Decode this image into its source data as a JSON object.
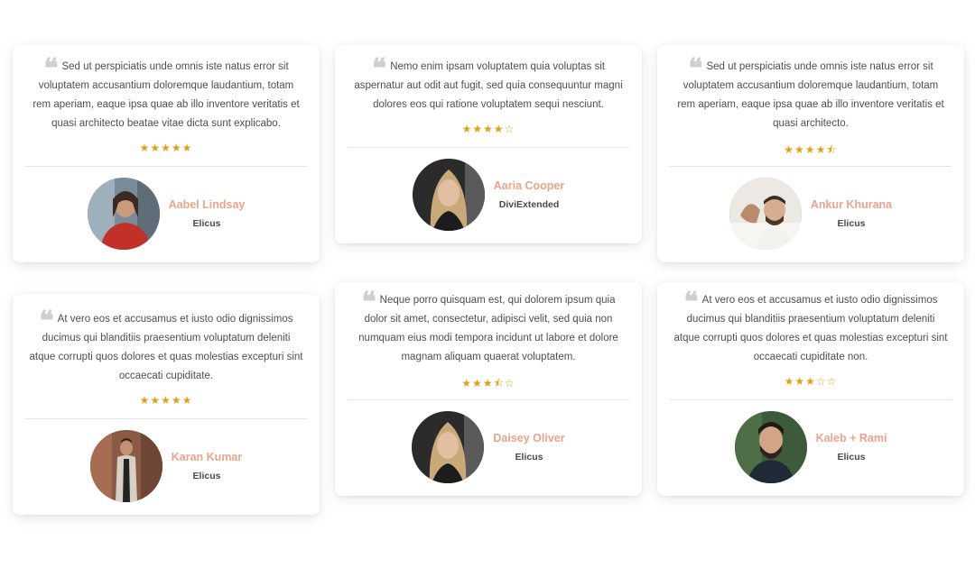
{
  "testimonials": [
    {
      "quote": "Sed ut perspiciatis unde omnis iste natus error sit voluptatem accusantium doloremque laudantium, totam rem aperiam, eaque ipsa quae ab illo inventore veritatis et quasi architecto beatae vitae dicta sunt explicabo.",
      "stars": "★★★★★",
      "rating": 5,
      "name": "Aabel Lindsay",
      "company": "Elicus"
    },
    {
      "quote": "Nemo enim ipsam voluptatem quia voluptas sit aspernatur aut odit aut fugit, sed quia consequuntur magni dolores eos qui ratione voluptatem sequi nesciunt.",
      "stars": "★★★★☆",
      "rating": 4,
      "name": "Aaria Cooper",
      "company": "DiviExtended"
    },
    {
      "quote": "Sed ut perspiciatis unde omnis iste natus error sit voluptatem accusantium doloremque laudantium, totam rem aperiam, eaque ipsa quae ab illo inventore veritatis et quasi architecto.",
      "stars": "★★★★⯪",
      "rating": 4.5,
      "name": "Ankur Khurana",
      "company": "Elicus"
    },
    {
      "quote": "At vero eos et accusamus et iusto odio dignissimos ducimus qui blanditiis praesentium voluptatum deleniti atque corrupti quos dolores et quas molestias excepturi sint occaecati cupiditate.",
      "stars": "★★★★★",
      "rating": 5,
      "name": "Karan Kumar",
      "company": "Elicus"
    },
    {
      "quote": "Neque porro quisquam est, qui dolorem ipsum quia dolor sit amet, consectetur, adipisci velit, sed quia non numquam eius modi tempora incidunt ut labore et dolore magnam aliquam quaerat voluptatem.",
      "stars": "★★★⯪☆",
      "rating": 3.5,
      "name": "Daisey Oliver",
      "company": "Elicus"
    },
    {
      "quote": "At vero eos et accusamus et iusto odio dignissimos ducimus qui blanditiis praesentium voluptatum deleniti atque corrupti quos dolores et quas molestias excepturi sint occaecati cupiditate non.",
      "stars": "★★★☆☆",
      "rating": 3,
      "name": "Kaleb + Rami",
      "company": "Elicus"
    }
  ],
  "colors": {
    "name_accent": "#e8a48c",
    "star": "#e0a11a",
    "quote_mark": "#cfcfcf"
  },
  "icons": {
    "quote": "quote-open-icon",
    "star": "star-icon"
  }
}
